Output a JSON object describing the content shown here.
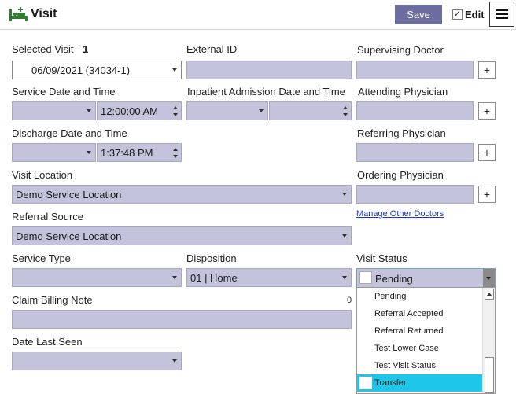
{
  "header": {
    "title": "Visit",
    "save_label": "Save",
    "edit_label": "Edit",
    "edit_checked": "✓"
  },
  "fields": {
    "selected_visit": {
      "label": "Selected Visit - ",
      "number": "1",
      "value": "06/09/2021 (34034-1)"
    },
    "external_id": {
      "label": "External ID",
      "value": ""
    },
    "supervising_doctor": {
      "label": "Supervising Doctor",
      "value": "",
      "add": "+"
    },
    "service_datetime": {
      "label": "Service Date and Time",
      "date": "",
      "time": "12:00:00 AM"
    },
    "inpatient_admission": {
      "label": "Inpatient Admission Date and Time",
      "date": "",
      "time": ""
    },
    "attending_physician": {
      "label": "Attending Physician",
      "value": "",
      "add": "+"
    },
    "discharge_datetime": {
      "label": "Discharge Date and Time",
      "date": "",
      "time": "1:37:48 PM"
    },
    "referring_physician": {
      "label": "Referring Physician",
      "value": "",
      "add": "+"
    },
    "visit_location": {
      "label": "Visit Location",
      "value": "Demo Service Location"
    },
    "ordering_physician": {
      "label": "Ordering Physician",
      "value": "",
      "add": "+"
    },
    "referral_source": {
      "label": "Referral Source",
      "value": "Demo Service Location"
    },
    "manage_doctors": {
      "label": "Manage Other Doctors"
    },
    "service_type": {
      "label": "Service Type",
      "value": ""
    },
    "disposition": {
      "label": "Disposition",
      "value": "01 | Home"
    },
    "visit_status": {
      "label": "Visit Status",
      "value": "Pending"
    },
    "claim_billing_note": {
      "label": "Claim Billing Note",
      "counter": "0",
      "value": ""
    },
    "date_last_seen": {
      "label": "Date Last Seen",
      "value": ""
    }
  },
  "status_options": [
    {
      "label": "Pending",
      "selected": false
    },
    {
      "label": "Referral Accepted",
      "selected": false
    },
    {
      "label": "Referral Returned",
      "selected": false
    },
    {
      "label": "Test Lower Case",
      "selected": false
    },
    {
      "label": "Test Visit Status",
      "selected": false
    },
    {
      "label": "Transfer",
      "selected": true
    }
  ],
  "colors": {
    "accent": "#6a6d9d",
    "field_bg": "#c3c3dc",
    "selected_option": "#1ec7e9",
    "link": "#1a37c8"
  },
  "icons": {
    "title_icon": "bed-plus-icon",
    "menu_icon": "hamburger-menu-icon"
  }
}
